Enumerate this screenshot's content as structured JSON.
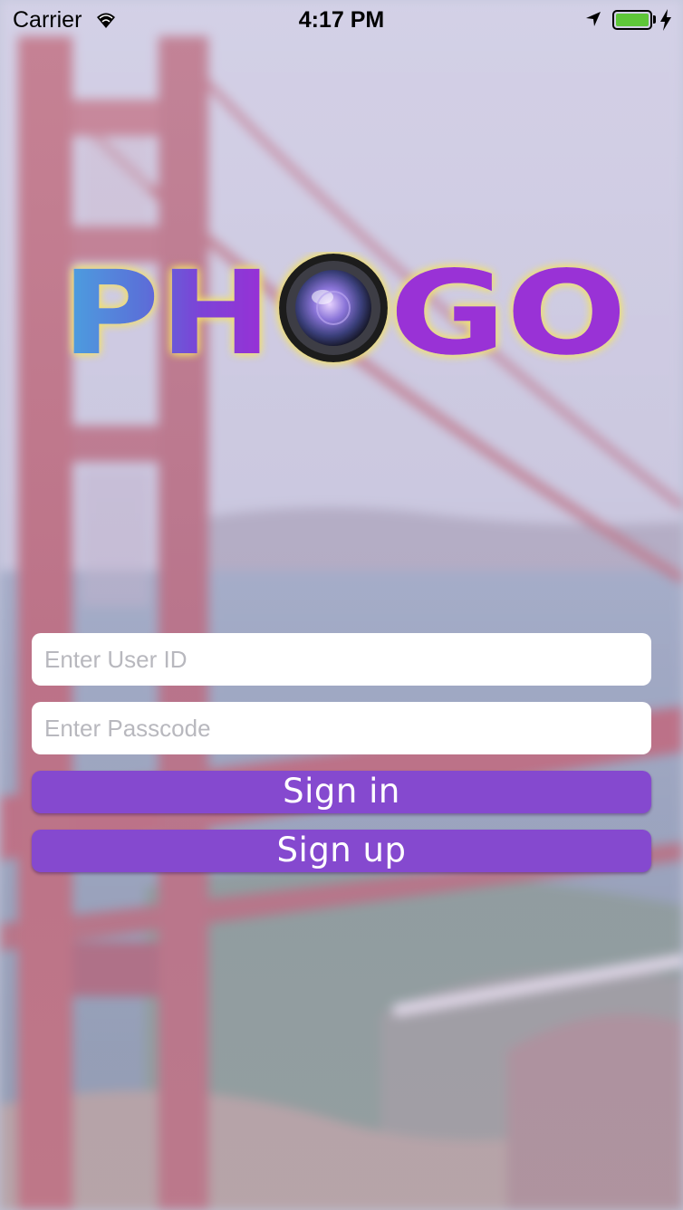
{
  "status_bar": {
    "carrier": "Carrier",
    "time": "4:17 PM",
    "battery_color": "#5ec639"
  },
  "logo": {
    "text_left": "PH",
    "text_right": "GO",
    "icon": "camera-lens-icon"
  },
  "login": {
    "user_id_placeholder": "Enter User ID",
    "passcode_placeholder": "Enter Passcode",
    "sign_in_label": "Sign in",
    "sign_up_label": "Sign up"
  },
  "colors": {
    "button": "#8549cf",
    "field_background": "#ffffff"
  }
}
